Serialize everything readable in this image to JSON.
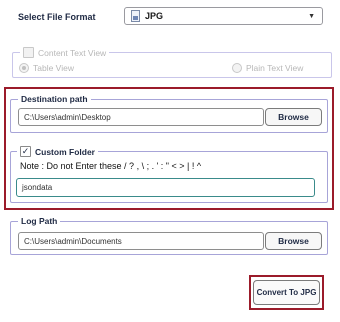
{
  "format": {
    "label": "Select File Format",
    "selected": "JPG",
    "icon": "file-image-icon"
  },
  "view_options": {
    "content_text_view": {
      "label": "Content Text View",
      "checked": false,
      "enabled": false
    },
    "table_view": {
      "label": "Table View",
      "selected": true
    },
    "plain_text_view": {
      "label": "Plain Text View",
      "selected": false
    }
  },
  "destination": {
    "label": "Destination path",
    "path": "C:\\Users\\admin\\Desktop",
    "browse_label": "Browse"
  },
  "custom_folder": {
    "label": "Custom Folder",
    "checked": true,
    "note": "Note : Do not Enter these  / ? , \\ ; . ' : \" < > | ! ^",
    "value": "jsondata"
  },
  "log_path": {
    "label": "Log Path",
    "path": "C:\\Users\\admin\\Documents",
    "browse_label": "Browse"
  },
  "convert_button_label": "Convert To JPG",
  "colors": {
    "highlight": "#9b1b2a",
    "group_border": "#a7a4d8",
    "focus_border": "#3a8b8b"
  }
}
